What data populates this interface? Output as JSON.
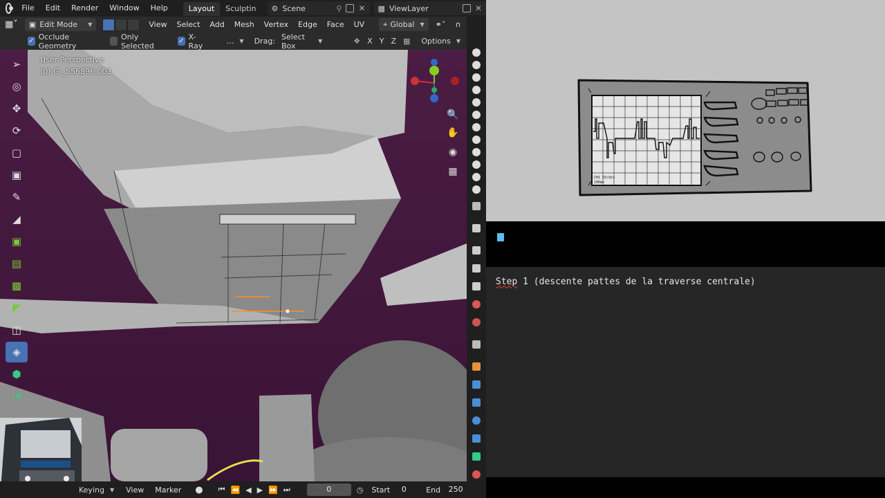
{
  "menubar": {
    "items": [
      "File",
      "Edit",
      "Render",
      "Window",
      "Help"
    ],
    "workspace_tabs": [
      "Layout",
      "Sculptin"
    ],
    "scene_label": "Scene",
    "viewlayer_label": "ViewLayer"
  },
  "header": {
    "mode": "Edit Mode",
    "menus": [
      "View",
      "Select",
      "Add",
      "Mesh",
      "Vertex",
      "Edge",
      "Face",
      "UV"
    ],
    "transform_orientation": "Global"
  },
  "toolheader": {
    "occlude_geometry": "Occlude Geometry",
    "only_selected": "Only Selected",
    "xray": "X-Ray",
    "more": "...",
    "drag_label": "Drag:",
    "drag_value": "Select Box",
    "axes": [
      "X",
      "Y",
      "Z"
    ],
    "options": "Options"
  },
  "viewport": {
    "perspective": "User Perspective",
    "object_name": "(0) G-_556896.003"
  },
  "timeline": {
    "keying": "Keying",
    "view": "View",
    "marker": "Marker",
    "current_frame": "0",
    "start_label": "Start",
    "start_value": "0",
    "end_label": "End",
    "end_value": "250"
  },
  "notes": {
    "step_word": "Step",
    "step_rest": " 1 (descente pattes de la traverse centrale)"
  },
  "sketch": {
    "screen_note_line1": "CH1  5V/div",
    "screen_note_line2": "100ms"
  },
  "colors": {
    "accent": "#4772b3",
    "header_bg": "#2b2b2b",
    "viewport_bg": "#4b1d44",
    "sketch_bg": "#c4c4c4"
  }
}
